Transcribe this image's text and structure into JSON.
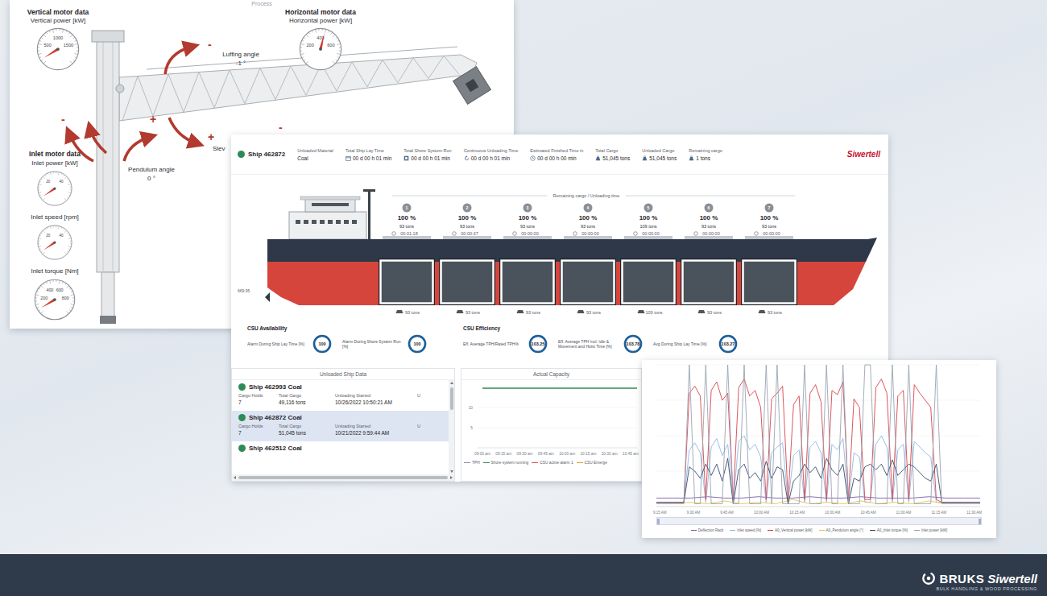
{
  "process": {
    "title": "Process",
    "vertical": {
      "heading": "Vertical motor data",
      "label": "Vertical power [kW]",
      "ticks": [
        "500",
        "1000",
        "1500"
      ],
      "level": 0.05
    },
    "horizontal": {
      "heading": "Horizontal motor data",
      "label": "Horizontal power [kW]",
      "ticks": [
        "200",
        "400",
        "600"
      ],
      "level": 0.55
    },
    "luffing": {
      "label": "Luffing angle",
      "value": "-1 °"
    },
    "pendulum": {
      "label": "Pendulum angle",
      "value": "0 °"
    },
    "slew": {
      "label": "Slev"
    },
    "signs": [
      "-",
      "-",
      "+",
      "+",
      "-"
    ],
    "inlet": {
      "heading": "Inlet motor data",
      "gauges": [
        {
          "label": "Inlet power [kW]",
          "ticks": [
            "20",
            "40"
          ],
          "level": 0.04
        },
        {
          "label": "Inlet speed [rpm]",
          "ticks": [
            "20",
            "40"
          ],
          "level": 0.04
        },
        {
          "label": "Inlet torque [Nm]",
          "ticks": [
            "200",
            "400",
            "600",
            "800"
          ],
          "level": 0.05
        }
      ]
    }
  },
  "ship": {
    "header": {
      "status_color": "#2e8b57",
      "ship": "Ship 462872",
      "fields": [
        {
          "label": "Unloaded Material",
          "value": "Coal",
          "kind": "plain"
        },
        {
          "label": "Total Ship Lay Time",
          "value": "00 d 00 h 01 min",
          "kind": "calendar"
        },
        {
          "label": "Total Shore System Run",
          "value": "00 d 00 h 01 min",
          "kind": "box"
        },
        {
          "label": "Continuous Unloading Time",
          "value": "00 d 00 h 01 min",
          "kind": "refresh"
        },
        {
          "label": "Estimated Finished Time in",
          "value": "00 d 00 h 00 min",
          "kind": "clock"
        },
        {
          "label": "Total Cargo",
          "value": "51,045 tons",
          "kind": "weight"
        },
        {
          "label": "Unloaded Cargo",
          "value": "51,045 tons",
          "kind": "weight"
        },
        {
          "label": "Remaining cargo",
          "value": "1 tons",
          "kind": "weight"
        }
      ],
      "logo": "Siwertell"
    },
    "remaining_label": "Remaining cargo / Unloading time",
    "draft": "669.95",
    "holds": [
      {
        "number": "1",
        "percent": "100 %",
        "tons": "93 tons",
        "time": "00:01:18",
        "bottom": "93 tons"
      },
      {
        "number": "2",
        "percent": "100 %",
        "tons": "93 tons",
        "time": "00:00:37",
        "bottom": "93 tons"
      },
      {
        "number": "3",
        "percent": "100 %",
        "tons": "93 tons",
        "time": "00:00:00",
        "bottom": "93 tons"
      },
      {
        "number": "4",
        "percent": "100 %",
        "tons": "93 tons",
        "time": "00:00:00",
        "bottom": "93 tons"
      },
      {
        "number": "5",
        "percent": "100 %",
        "tons": "109 tons",
        "time": "00:00:00",
        "bottom": "109 tons"
      },
      {
        "number": "6",
        "percent": "100 %",
        "tons": "93 tons",
        "time": "00:00:00",
        "bottom": "93 tons"
      },
      {
        "number": "7",
        "percent": "100 %",
        "tons": "93 tons",
        "time": "00:00:00",
        "bottom": "93 tons"
      }
    ],
    "availability": {
      "title": "CSU Availability",
      "items": [
        {
          "label": "Alarm During Ship Lay Time [%]",
          "value": "100",
          "level": 1
        },
        {
          "label": "Alarm During Shore System Run [%]",
          "value": "100",
          "level": 1
        }
      ]
    },
    "efficiency": {
      "title": "CSU Efficiency",
      "items": [
        {
          "label": "Eff. Average TPH/Rated TPH%",
          "value": "103.25",
          "level": 1
        },
        {
          "label": "Eff. Average TPH Incl. Idle & Movement and Hoist Time [%]",
          "value": "103.78",
          "level": 1
        },
        {
          "label": "Avg During Ship Lay Time [%]",
          "value": "103.27",
          "level": 1
        }
      ]
    },
    "unloaded": {
      "title": "Unloaded Ship Data",
      "columns": [
        "Cargo Holds",
        "Total Cargo",
        "Unloading Started",
        "U"
      ],
      "ships": [
        {
          "name": "Ship 462993 Coal",
          "values": [
            "7",
            "49,116 tons",
            "10/26/2022 10:50:21 AM"
          ],
          "selected": false,
          "color": "#2e8b57"
        },
        {
          "name": "Ship 462872 Coal",
          "values": [
            "7",
            "51,045 tons",
            "10/21/2022 9:59:44 AM"
          ],
          "selected": true,
          "color": "#2e8b57"
        },
        {
          "name": "Ship 462512 Coal",
          "values": [],
          "selected": false,
          "color": "#2e8b57"
        }
      ]
    },
    "capacity": {
      "title": "Actual Capacity",
      "y_ticks": [
        "10",
        "5"
      ],
      "x_ticks": [
        "09:00 am",
        "09:15 am",
        "09:30 am",
        "09:45 am",
        "10:00 am",
        "10:15 am",
        "10:30 am",
        "10:45 am"
      ],
      "series": [
        {
          "name": "TPH",
          "color": "#7d8da1",
          "values": []
        },
        {
          "name": "Shore system running",
          "color": "#2e8b57",
          "values": [
            14.8,
            14.8,
            14.8,
            14.8,
            14.8,
            14.8,
            14.8,
            14.8
          ]
        },
        {
          "name": "CSU active alarm 1",
          "color": "#d9534f",
          "values": []
        },
        {
          "name": "CSU Emerge",
          "color": "#e0a030",
          "values": []
        }
      ]
    }
  },
  "trend": {
    "x_ticks": [
      "9:15 AM",
      "9:30 AM",
      "9:45 AM",
      "10:00 AM",
      "10:15 AM",
      "10:30 AM",
      "10:45 AM",
      "11:00 AM",
      "11:15 AM",
      "11:30 AM"
    ],
    "series": [
      {
        "name": "Deflection Rack",
        "color": "#7b61a8",
        "values": [
          6,
          6,
          6,
          7,
          6,
          6,
          7,
          6,
          6,
          7,
          6,
          6,
          7,
          6,
          6,
          6,
          7,
          6,
          6,
          6
        ]
      },
      {
        "name": "Inlet speed [%]",
        "color": "#8fb8e8",
        "values": [
          3,
          3,
          3,
          3,
          3,
          3,
          40,
          45,
          38,
          3,
          42,
          48,
          36,
          44,
          3,
          46,
          50,
          40,
          44,
          35,
          3,
          38,
          42,
          45,
          3,
          36,
          40,
          3,
          42,
          46,
          38,
          3,
          44,
          40,
          48,
          3,
          38,
          35,
          3,
          3,
          44,
          50,
          42,
          3,
          40,
          44,
          3,
          46,
          42,
          38,
          35,
          3,
          3,
          3,
          3,
          3,
          3,
          3,
          3,
          3
        ]
      },
      {
        "name": "A0_Vertical power [kW]",
        "color": "#d9434a",
        "values": [
          3,
          3,
          3,
          3,
          3,
          3,
          80,
          85,
          78,
          5,
          82,
          88,
          75,
          80,
          5,
          84,
          90,
          78,
          82,
          70,
          5,
          76,
          80,
          85,
          5,
          72,
          78,
          5,
          80,
          86,
          74,
          5,
          82,
          79,
          88,
          5,
          76,
          70,
          5,
          5,
          84,
          90,
          80,
          5,
          78,
          82,
          5,
          86,
          80,
          75,
          70,
          5,
          3,
          3,
          3,
          3,
          3,
          3,
          3,
          3
        ]
      },
      {
        "name": "A0_Pendulum angle [°]",
        "color": "#e8c34a",
        "values": [
          2,
          2,
          3,
          2,
          4,
          2,
          3,
          2,
          5,
          2,
          3,
          2,
          4,
          2,
          3,
          2,
          4,
          2,
          2,
          2
        ]
      },
      {
        "name": "A0_Inlet torque [%]",
        "color": "#3b4a6b",
        "values": [
          3,
          3,
          3,
          3,
          3,
          3,
          28,
          25,
          20,
          30,
          22,
          30,
          18,
          34,
          2,
          26,
          30,
          20,
          24,
          18,
          32,
          20,
          28,
          26,
          2,
          18,
          22,
          30,
          24,
          28,
          20,
          34,
          26,
          22,
          30,
          2,
          20,
          18,
          28,
          30,
          26,
          30,
          22,
          33,
          22,
          26,
          30,
          28,
          24,
          20,
          18,
          30,
          3,
          3,
          3,
          3,
          3,
          3,
          3,
          3
        ]
      },
      {
        "name": "Inlet power [kW]",
        "color": "#9aa4b1",
        "values": [
          2,
          2,
          2,
          2,
          2,
          2,
          100,
          2,
          2,
          100,
          2,
          2,
          2,
          100,
          2,
          2,
          100,
          2,
          2,
          2,
          100,
          2,
          100,
          2,
          2,
          2,
          2,
          100,
          2,
          2,
          2,
          100,
          2,
          2,
          100,
          2,
          2,
          2,
          100,
          100,
          2,
          2,
          2,
          100,
          2,
          2,
          100,
          2,
          2,
          2,
          2,
          100,
          2,
          2,
          2,
          2,
          2,
          2,
          2,
          2
        ]
      }
    ]
  },
  "footer": {
    "brand": "BRUKS",
    "name": "Siwertell",
    "tagline": "BULK HANDLING & WOOD PROCESSING"
  }
}
